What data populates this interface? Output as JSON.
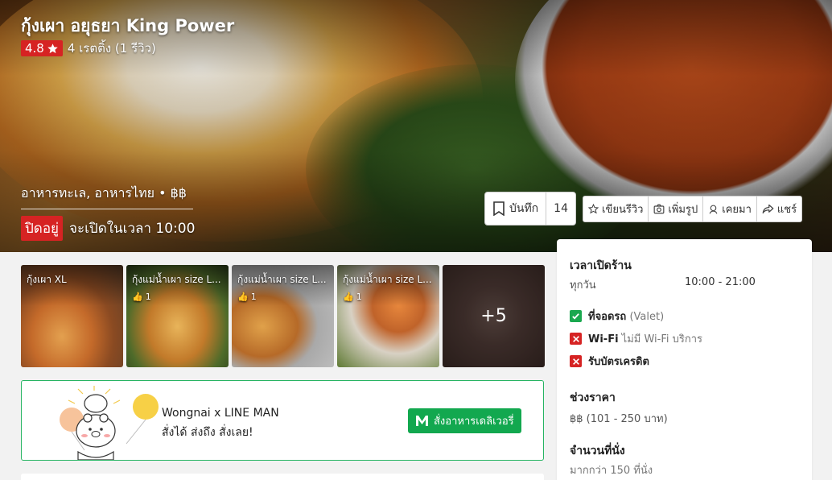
{
  "restaurant": {
    "name": "กุ้งเผา อยุธยา King Power",
    "rating": "4.8",
    "rating_text": "4 เรตติ้ง (1 รีวิว)",
    "categories": "อาหารทะเล, อาหารไทย • ฿฿",
    "status": "ปิดอยู่",
    "opening_text": "จะเปิดในเวลา 10:00"
  },
  "bookmark": {
    "label": "บันทึก",
    "count": "14"
  },
  "actions": [
    {
      "label": "เขียนรีวิว",
      "icon": "star-outline-icon"
    },
    {
      "label": "เพิ่มรูป",
      "icon": "camera-icon"
    },
    {
      "label": "เคยมา",
      "icon": "checkin-icon"
    },
    {
      "label": "แชร์",
      "icon": "share-icon"
    }
  ],
  "photos": [
    {
      "caption": "กุ้งเผา XL",
      "likes": ""
    },
    {
      "caption": "กุ้งแม่น้ำเผา size L...",
      "likes": "1"
    },
    {
      "caption": "กุ้งแม่น้ำเผา size L...",
      "likes": "1"
    },
    {
      "caption": "กุ้งแม่น้ำเผา size L...",
      "likes": "1"
    },
    {
      "caption": "",
      "more": "+5"
    }
  ],
  "promo": {
    "line1": "Wongnai x LINE MAN",
    "line2": "สั่งได้ ส่งถึง สั่งเลย!",
    "button": "สั่งอาหารเดลิเวอรี่"
  },
  "sidebar": {
    "hours_title": "เวลาเปิดร้าน",
    "hours_day": "ทุกวัน",
    "hours_time": "10:00 - 21:00",
    "amenities": [
      {
        "label": "ที่จอดรถ",
        "note": "(Valet)",
        "available": true
      },
      {
        "label": "Wi-Fi",
        "note": "ไม่มี Wi-Fi บริการ",
        "available": false
      },
      {
        "label": "รับบัตรเครดิต",
        "note": "",
        "available": false
      }
    ],
    "price_title": "ช่วงราคา",
    "price_value": "฿฿ (101 - 250 บาท)",
    "seats_title": "จำนวนที่นั่ง",
    "seats_value": "มากกว่า 150 ที่นั่ง"
  },
  "colors": {
    "accent_red": "#d62323",
    "line_green": "#12a84f",
    "border_green": "#27b463"
  }
}
